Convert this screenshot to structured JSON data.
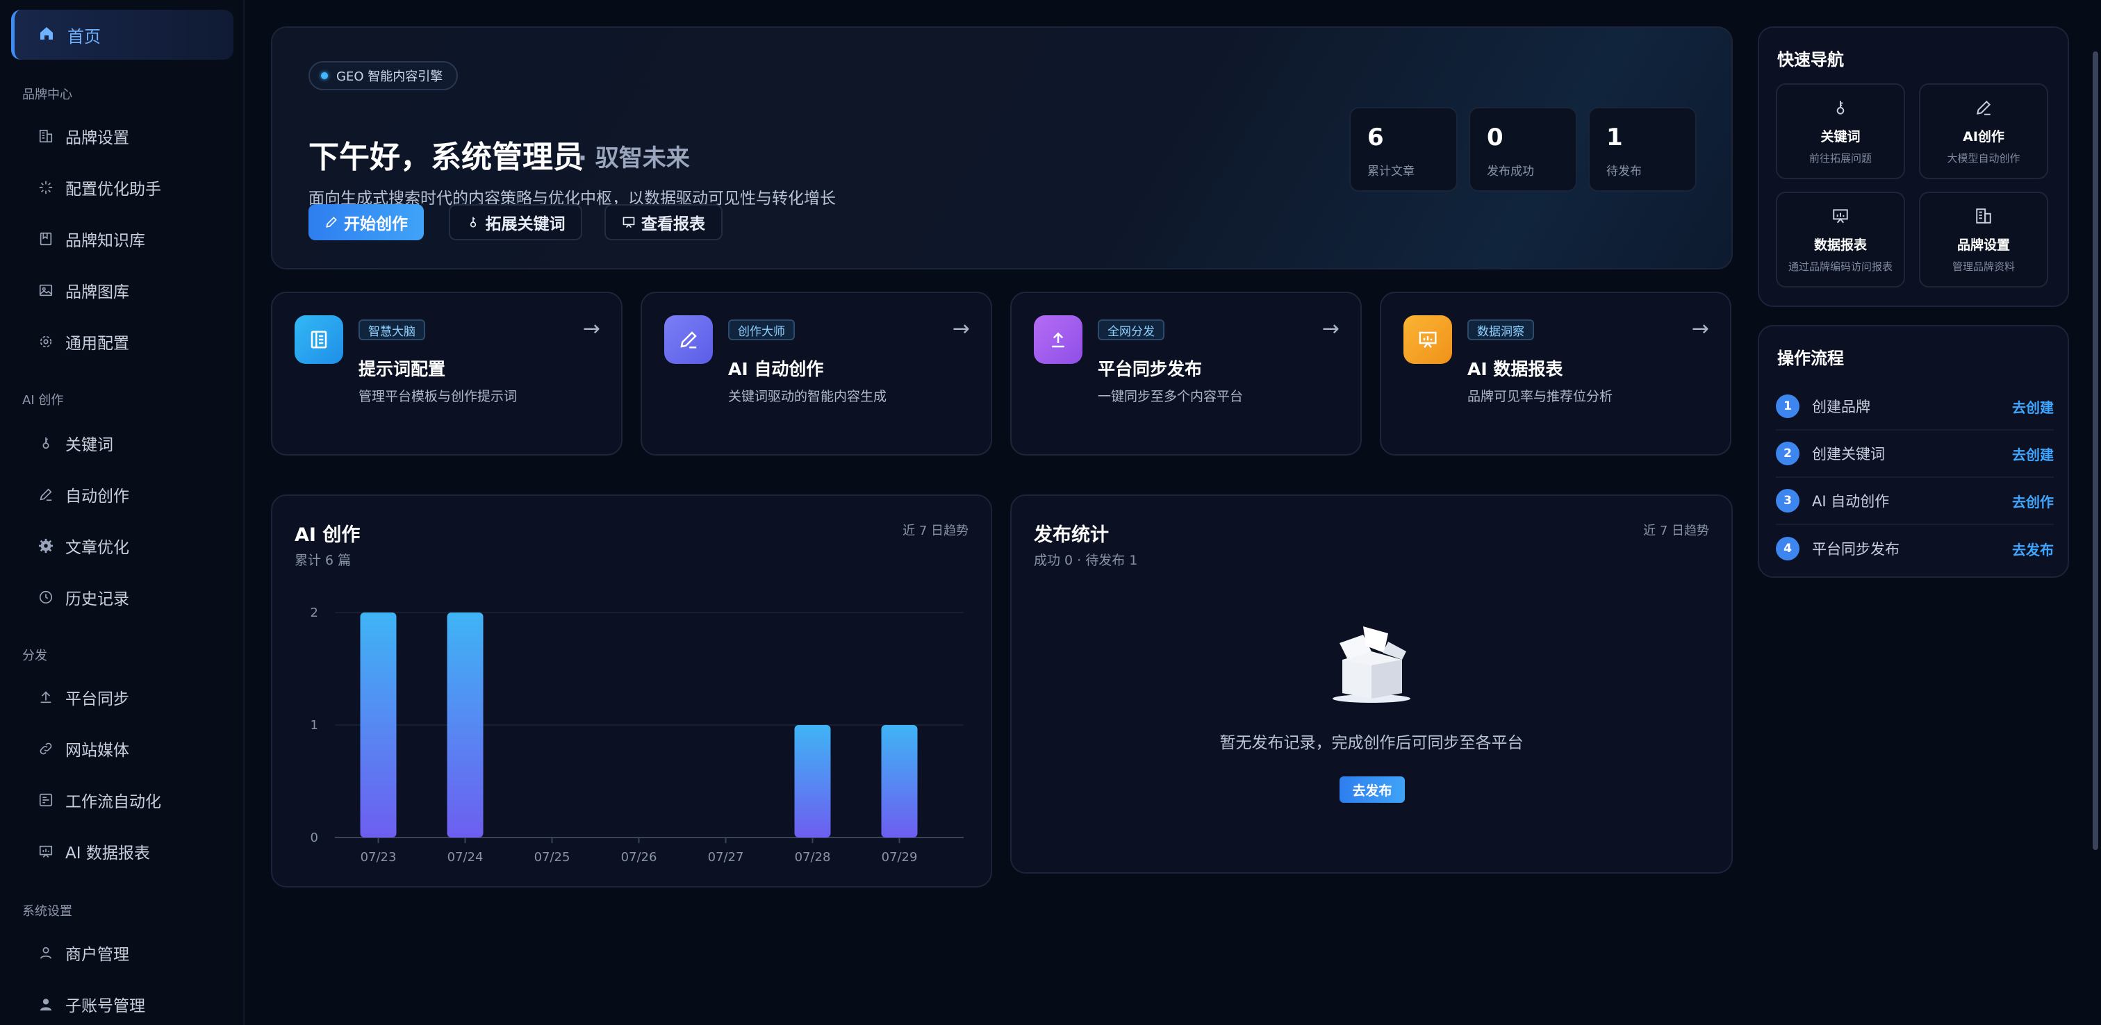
{
  "sidebar": {
    "home": "首页",
    "groups": [
      {
        "title": "品牌中心",
        "items": [
          {
            "label": "品牌设置",
            "icon": "building-icon"
          },
          {
            "label": "配置优化助手",
            "icon": "sparkle-icon"
          },
          {
            "label": "品牌知识库",
            "icon": "book-icon"
          },
          {
            "label": "品牌图库",
            "icon": "image-icon"
          },
          {
            "label": "通用配置",
            "icon": "gear-icon"
          }
        ]
      },
      {
        "title": "AI 创作",
        "items": [
          {
            "label": "关键词",
            "icon": "key-icon"
          },
          {
            "label": "自动创作",
            "icon": "pen-icon"
          },
          {
            "label": "文章优化",
            "icon": "cog-filled-icon"
          },
          {
            "label": "历史记录",
            "icon": "clock-icon"
          }
        ]
      },
      {
        "title": "分发",
        "items": [
          {
            "label": "平台同步",
            "icon": "upload-icon"
          },
          {
            "label": "网站媒体",
            "icon": "link-icon"
          },
          {
            "label": "工作流自动化",
            "icon": "workflow-icon"
          },
          {
            "label": "AI 数据报表",
            "icon": "report-icon"
          }
        ]
      },
      {
        "title": "系统设置",
        "items": [
          {
            "label": "商户管理",
            "icon": "user-icon"
          },
          {
            "label": "子账号管理",
            "icon": "user-filled-icon"
          }
        ]
      }
    ]
  },
  "hero": {
    "badge": "GEO 智能内容引擎",
    "title": "下午好，系统管理员",
    "subtitle": "· 驭智未来",
    "description": "面向生成式搜索时代的内容策略与优化中枢，以数据驱动可见性与转化增长",
    "buttons": {
      "start": "开始创作",
      "keywords": "拓展关键词",
      "report": "查看报表"
    },
    "stats": [
      {
        "value": "6",
        "label": "累计文章"
      },
      {
        "value": "0",
        "label": "发布成功"
      },
      {
        "value": "1",
        "label": "待发布"
      }
    ]
  },
  "cards": [
    {
      "tag": "智慧大脑",
      "title": "提示词配置",
      "desc": "管理平台模板与创作提示词",
      "icon": "document-icon",
      "color": "#29a7f2"
    },
    {
      "tag": "创作大师",
      "title": "AI 自动创作",
      "desc": "关键词驱动的智能内容生成",
      "icon": "pen-icon",
      "color": "#6e6ff0"
    },
    {
      "tag": "全网分发",
      "title": "平台同步发布",
      "desc": "一键同步至多个内容平台",
      "icon": "upload-icon",
      "color": "#a65df0"
    },
    {
      "tag": "数据洞察",
      "title": "AI 数据报表",
      "desc": "品牌可见率与推荐位分析",
      "icon": "report-icon",
      "color": "#f5a623"
    }
  ],
  "ai_chart": {
    "title": "AI 创作",
    "subtitle": "累计 6 篇",
    "trend": "近 7 日趋势"
  },
  "chart_data": {
    "type": "bar",
    "categories": [
      "07/23",
      "07/24",
      "07/25",
      "07/26",
      "07/27",
      "07/28",
      "07/29"
    ],
    "values": [
      2,
      2,
      0,
      0,
      0,
      1,
      1
    ],
    "yticks": [
      "0",
      "1",
      "2"
    ],
    "ylim": [
      0,
      2
    ],
    "colors": {
      "top": "#3fb4f5",
      "bottom": "#6d5ef0"
    }
  },
  "publish": {
    "title": "发布统计",
    "subtitle": "成功 0 · 待发布 1",
    "trend": "近 7 日趋势",
    "empty_message": "暂无发布记录，完成创作后可同步至各平台",
    "empty_button": "去发布"
  },
  "quick_nav": {
    "title": "快速导航",
    "items": [
      {
        "name": "关键词",
        "desc": "前往拓展问题",
        "icon": "key-icon"
      },
      {
        "name": "AI创作",
        "desc": "大模型自动创作",
        "icon": "pen-icon"
      },
      {
        "name": "数据报表",
        "desc": "通过品牌编码访问报表",
        "icon": "report-icon"
      },
      {
        "name": "品牌设置",
        "desc": "管理品牌资料",
        "icon": "building-icon"
      }
    ]
  },
  "flow": {
    "title": "操作流程",
    "steps": [
      {
        "num": "1",
        "label": "创建品牌",
        "action": "去创建"
      },
      {
        "num": "2",
        "label": "创建关键词",
        "action": "去创建"
      },
      {
        "num": "3",
        "label": "AI 自动创作",
        "action": "去创作"
      },
      {
        "num": "4",
        "label": "平台同步发布",
        "action": "去发布"
      }
    ]
  }
}
